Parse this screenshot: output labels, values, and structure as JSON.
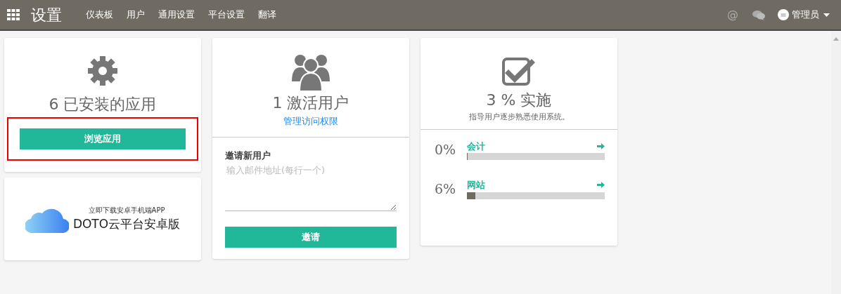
{
  "navbar": {
    "title": "设置",
    "menu": [
      {
        "label": "仪表板"
      },
      {
        "label": "用户"
      },
      {
        "label": "通用设置"
      },
      {
        "label": "平台设置"
      },
      {
        "label": "翻译"
      }
    ],
    "user": "管理员",
    "mention": "@"
  },
  "apps_card": {
    "count_title": "6 已安装的应用",
    "button": "浏览应用",
    "highlighted": true
  },
  "banner": {
    "subtitle": "立即下载安卓手机端APP",
    "title": "DOTO云平台安卓版"
  },
  "users_card": {
    "count_title": "1 激活用户",
    "link": "管理访问权限",
    "invite_label": "邀请新用户",
    "placeholder": "输入邮件地址(每行一个)",
    "button": "邀请"
  },
  "implementation_card": {
    "title": "3 % 实施",
    "subtitle": "指导用户逐步熟悉使用系统。",
    "items": [
      {
        "percent": "0%",
        "name": "会计",
        "level": 0
      },
      {
        "percent": "6%",
        "name": "网站",
        "level": 0.06
      }
    ]
  }
}
